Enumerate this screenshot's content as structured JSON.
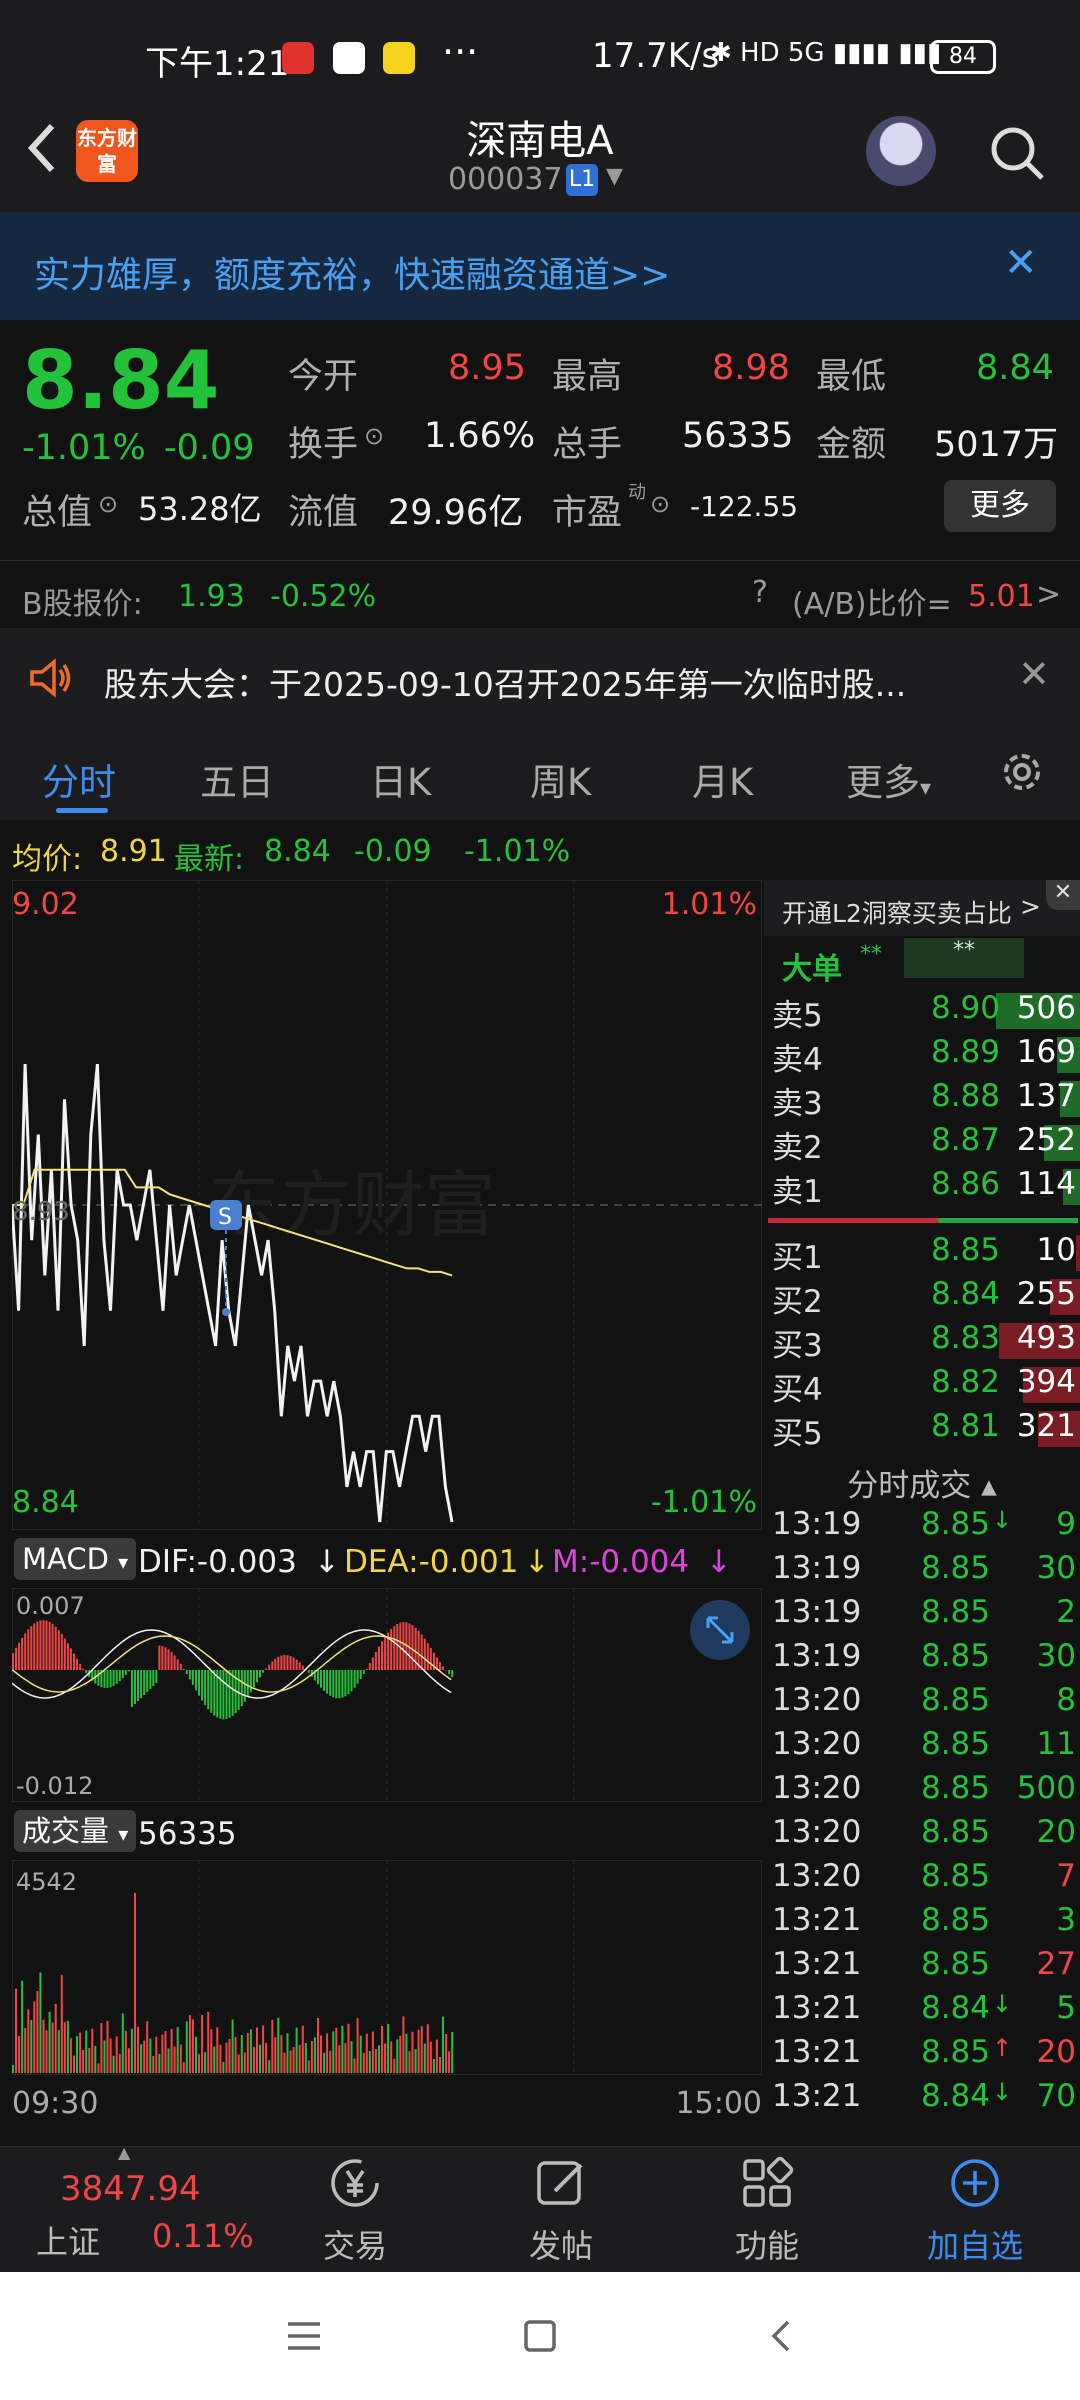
{
  "status_bar": {
    "time": "下午1:21",
    "more": "···",
    "speed": "17.7K/s",
    "icons_text": "✱ HD 5G ▮▮▮▮ ▮▮▮",
    "battery": "84"
  },
  "header": {
    "back_icon": "chevron-left-icon",
    "logo_text": "东方财富",
    "stock_name": "深南电A",
    "stock_code": "000037",
    "level_badge": "L1",
    "assistant_icon": "robot-avatar-icon",
    "search_icon": "search-icon"
  },
  "banner": {
    "text": "实力雄厚，额度充裕，快速融资通道>>",
    "close": "✕"
  },
  "quote": {
    "price": "8.84",
    "change_pct": "-1.01%",
    "change": "-0.09",
    "open_label": "今开",
    "open": "8.95",
    "high_label": "最高",
    "high": "8.98",
    "low_label": "最低",
    "low": "8.84",
    "turnover_label": "换手",
    "turnover": "1.66%",
    "volume_label": "总手",
    "volume": "56335",
    "amount_label": "金额",
    "amount": "5017万",
    "mktcap_label": "总值",
    "mktcap": "53.28亿",
    "float_label": "流值",
    "float": "29.96亿",
    "pe_label": "市盈",
    "pe_sup": "动",
    "pe": "-122.55",
    "more_button": "更多"
  },
  "b_share": {
    "label": "B股报价:",
    "price": "1.93",
    "change_pct": "-0.52%",
    "ratio_label": "(A/B)比价=",
    "ratio": "5.01",
    "arrow": ">"
  },
  "notice": {
    "text": "股东大会：于2025-09-10召开2025年第一次临时股...",
    "close": "✕"
  },
  "tabs": {
    "items": [
      "分时",
      "五日",
      "日K",
      "周K",
      "月K",
      "更多"
    ],
    "more_caret": "▾",
    "active": 0
  },
  "avg_row": {
    "avg_label": "均价:",
    "avg": "8.91",
    "latest_label": "最新:",
    "latest": "8.84",
    "change": "-0.09",
    "change_pct": "-1.01%"
  },
  "intraday": {
    "y_max": "9.02",
    "y_min": "8.84",
    "y_max_pct": "1.01%",
    "y_min_pct": "-1.01%",
    "prev_close": "8.93",
    "watermark": "东方财富",
    "marker": "S"
  },
  "chart_data": {
    "type": "line",
    "ylim": [
      8.84,
      9.02
    ],
    "prev_close": 8.93,
    "x_start": "09:30",
    "x_end": "15:00",
    "series": [
      {
        "name": "最新",
        "values": [
          8.93,
          8.9,
          8.97,
          8.92,
          8.95,
          8.91,
          8.94,
          8.9,
          8.96,
          8.93,
          8.92,
          8.89,
          8.95,
          8.97,
          8.92,
          8.9,
          8.94,
          8.93,
          8.93,
          8.92,
          8.93,
          8.94,
          8.92,
          8.9,
          8.93,
          8.91,
          8.92,
          8.93,
          8.92,
          8.91,
          8.9,
          8.89,
          8.92,
          8.9,
          8.89,
          8.91,
          8.93,
          8.92,
          8.91,
          8.92,
          8.9,
          8.87,
          8.89,
          8.88,
          8.89,
          8.87,
          8.88,
          8.88,
          8.87,
          8.88,
          8.87,
          8.85,
          8.86,
          8.85,
          8.86,
          8.86,
          8.84,
          8.86,
          8.86,
          8.85,
          8.86,
          8.87,
          8.87,
          8.86,
          8.87,
          8.87,
          8.85,
          8.84
        ]
      },
      {
        "name": "均价",
        "values": [
          8.93,
          8.93,
          8.94,
          8.94,
          8.94,
          8.94,
          8.94,
          8.94,
          8.94,
          8.94,
          8.94,
          8.935,
          8.935,
          8.935,
          8.933,
          8.932,
          8.931,
          8.93,
          8.929,
          8.928,
          8.927,
          8.926,
          8.925,
          8.924,
          8.923,
          8.922,
          8.921,
          8.92,
          8.919,
          8.918,
          8.917,
          8.916,
          8.915,
          8.914,
          8.913,
          8.912,
          8.912,
          8.911,
          8.911,
          8.91
        ]
      }
    ]
  },
  "macd": {
    "label": "MACD",
    "caret": "▾",
    "dif": "DIF:-0.003",
    "dea": "DEA:-0.001",
    "m": "M:-0.004",
    "arrow": "↓",
    "y_max": "0.007",
    "y_min": "-0.012",
    "expand_icon": "expand-icon"
  },
  "volume": {
    "label": "成交量",
    "caret": "▾",
    "value": "56335",
    "y_max": "4542",
    "x_start": "09:30",
    "x_end": "15:00"
  },
  "orderbook": {
    "header": "开通L2洞察买卖占比",
    "header_arrow": ">",
    "close": "✕",
    "big_label": "大单",
    "big_v1": "**",
    "big_v2": "**",
    "asks": [
      {
        "label": "卖5",
        "price": "8.90",
        "vol": "506",
        "bar": 0.5
      },
      {
        "label": "卖4",
        "price": "8.89",
        "vol": "169",
        "bar": 0.12
      },
      {
        "label": "卖3",
        "price": "8.88",
        "vol": "137",
        "bar": 0.1
      },
      {
        "label": "卖2",
        "price": "8.87",
        "vol": "252",
        "bar": 0.2
      },
      {
        "label": "卖1",
        "price": "8.86",
        "vol": "114",
        "bar": 0.08
      }
    ],
    "bids": [
      {
        "label": "买1",
        "price": "8.85",
        "vol": "10",
        "bar": 0.0
      },
      {
        "label": "买2",
        "price": "8.84",
        "vol": "255",
        "bar": 0.16
      },
      {
        "label": "买3",
        "price": "8.83",
        "vol": "493",
        "bar": 0.48
      },
      {
        "label": "买4",
        "price": "8.82",
        "vol": "394",
        "bar": 0.33
      },
      {
        "label": "买5",
        "price": "8.81",
        "vol": "321",
        "bar": 0.24
      }
    ],
    "ticks_title": "分时成交",
    "ticks_caret": "▴",
    "ticks": [
      {
        "time": "13:19",
        "price": "8.85",
        "dir": "↓",
        "vol": "9",
        "side": "sell"
      },
      {
        "time": "13:19",
        "price": "8.85",
        "dir": "",
        "vol": "30",
        "side": "sell"
      },
      {
        "time": "13:19",
        "price": "8.85",
        "dir": "",
        "vol": "2",
        "side": "sell"
      },
      {
        "time": "13:19",
        "price": "8.85",
        "dir": "",
        "vol": "30",
        "side": "sell"
      },
      {
        "time": "13:20",
        "price": "8.85",
        "dir": "",
        "vol": "8",
        "side": "sell"
      },
      {
        "time": "13:20",
        "price": "8.85",
        "dir": "",
        "vol": "11",
        "side": "sell"
      },
      {
        "time": "13:20",
        "price": "8.85",
        "dir": "",
        "vol": "500",
        "side": "sell"
      },
      {
        "time": "13:20",
        "price": "8.85",
        "dir": "",
        "vol": "20",
        "side": "sell"
      },
      {
        "time": "13:20",
        "price": "8.85",
        "dir": "",
        "vol": "7",
        "side": "buy"
      },
      {
        "time": "13:21",
        "price": "8.85",
        "dir": "",
        "vol": "3",
        "side": "sell"
      },
      {
        "time": "13:21",
        "price": "8.85",
        "dir": "",
        "vol": "27",
        "side": "buy"
      },
      {
        "time": "13:21",
        "price": "8.84",
        "dir": "↓",
        "vol": "5",
        "side": "sell"
      },
      {
        "time": "13:21",
        "price": "8.85",
        "dir": "↑",
        "vol": "20",
        "side": "buy"
      },
      {
        "time": "13:21",
        "price": "8.84",
        "dir": "↓",
        "vol": "70",
        "side": "sell"
      }
    ]
  },
  "bottom_nav": {
    "index_value": "3847.94",
    "index_name": "上证",
    "index_change": "0.11%",
    "items": [
      {
        "label": "交易",
        "icon": "yen-cycle-icon"
      },
      {
        "label": "发帖",
        "icon": "edit-icon"
      },
      {
        "label": "功能",
        "icon": "grid-icon"
      },
      {
        "label": "加自选",
        "icon": "add-circle-icon"
      }
    ]
  },
  "colors": {
    "up": "#f24545",
    "down": "#23c23b",
    "accent": "#3c8df2",
    "avg_line": "#f2e27a"
  }
}
